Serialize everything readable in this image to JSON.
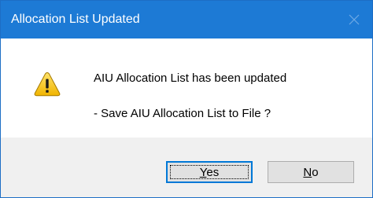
{
  "dialog": {
    "title": "Allocation List Updated",
    "message_line1": "AIU Allocation List has been updated",
    "message_line2": "- Save AIU Allocation List to File ?",
    "icon": "warning-icon",
    "buttons": {
      "yes": {
        "mnemonic": "Y",
        "rest": "es",
        "focused": true
      },
      "no": {
        "mnemonic": "N",
        "rest": "o",
        "focused": false
      }
    }
  },
  "colors": {
    "title_bar": "#1d7ad5",
    "content_bg": "#ffffff",
    "button_area_bg": "#f0f0f0",
    "focus_border": "#0078d7",
    "warning_fill": "#f5c518"
  }
}
